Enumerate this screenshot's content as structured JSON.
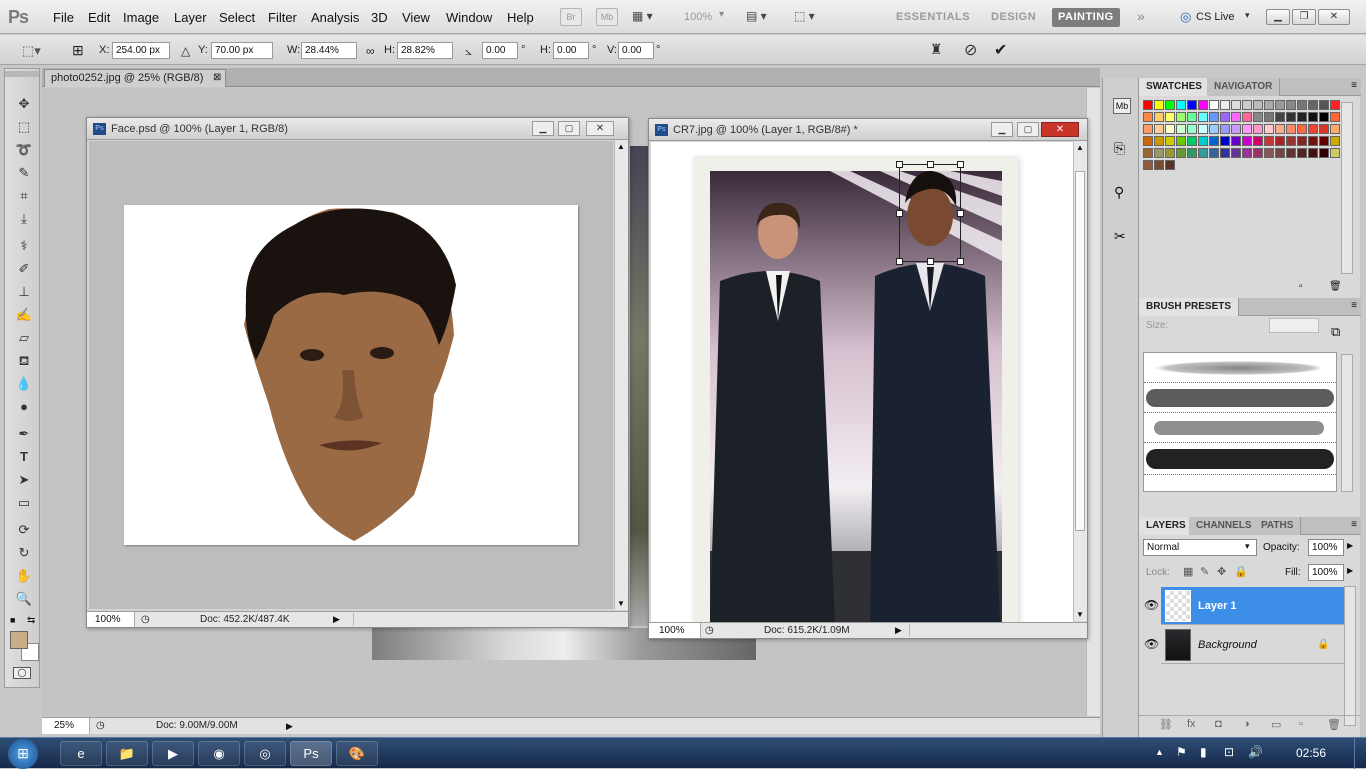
{
  "app": {
    "logo": "Ps"
  },
  "menu": [
    "File",
    "Edit",
    "Image",
    "Layer",
    "Select",
    "Filter",
    "Analysis",
    "3D",
    "View",
    "Window",
    "Help"
  ],
  "topbar": {
    "bridge": "Br",
    "minibridge": "Mb",
    "zoom": "100%",
    "workspaces": [
      "ESSENTIALS",
      "DESIGN",
      "PAINTING"
    ],
    "cslive": "CS Live"
  },
  "options": {
    "x_label": "X:",
    "x": "254.00 px",
    "y_label": "Y:",
    "y": "70.00 px",
    "w_label": "W:",
    "w": "28.44%",
    "h_label": "H:",
    "h": "28.82%",
    "rot": "0.00",
    "deg": "°",
    "hs_label": "H:",
    "hs": "0.00",
    "v_label": "V:",
    "v": "0.00"
  },
  "doc_tab": {
    "title": "photo0252.jpg @ 25% (RGB/8)"
  },
  "face_window": {
    "title": "Face.psd @ 100% (Layer 1, RGB/8)",
    "zoom": "100%",
    "doc": "Doc: 452.2K/487.4K"
  },
  "cr7_window": {
    "title": "CR7.jpg @ 100% (Layer 1, RGB/8#) *",
    "zoom": "100%",
    "doc": "Doc: 615.2K/1.09M"
  },
  "main_status": {
    "zoom": "25%",
    "doc": "Doc: 9.00M/9.00M"
  },
  "panels": {
    "swatches_tab": "SWATCHES",
    "navigator_tab": "NAVIGATOR",
    "brush_presets_tab": "BRUSH PRESETS",
    "size_label": "Size:",
    "layers_tab": "LAYERS",
    "channels_tab": "CHANNELS",
    "paths_tab": "PATHS",
    "blend_mode": "Normal",
    "opacity_label": "Opacity:",
    "opacity": "100%",
    "lock_label": "Lock:",
    "fill_label": "Fill:",
    "fill": "100%",
    "layers": [
      {
        "name": "Layer 1",
        "selected": true
      },
      {
        "name": "Background",
        "selected": false,
        "locked": true
      }
    ]
  },
  "taskbar": {
    "clock": "02:56"
  },
  "colors": {
    "accent_layer": "#3d8ee8",
    "foreground": "#c9ad88",
    "taskbar": "#1d355c"
  }
}
